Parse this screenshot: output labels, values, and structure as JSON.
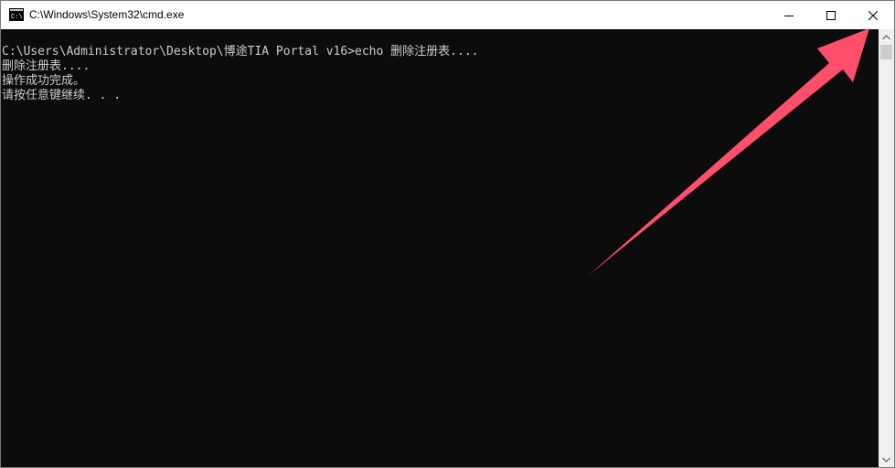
{
  "window": {
    "title": "C:\\Windows\\System32\\cmd.exe",
    "app_icon": "cmd-icon",
    "caption_buttons": [
      "minimize-icon",
      "maximize-icon",
      "close-icon"
    ]
  },
  "console": {
    "lines": [
      "C:\\Users\\Administrator\\Desktop\\博途TIA Portal v16>echo 删除注册表....",
      "删除注册表....",
      "操作成功完成。",
      "请按任意键继续. . ."
    ],
    "background_color": "#0c0c0c",
    "text_color": "#cccccc"
  },
  "annotation": {
    "icon": "red-arrow-pointing-to-close",
    "color": "#ff4f6a"
  }
}
